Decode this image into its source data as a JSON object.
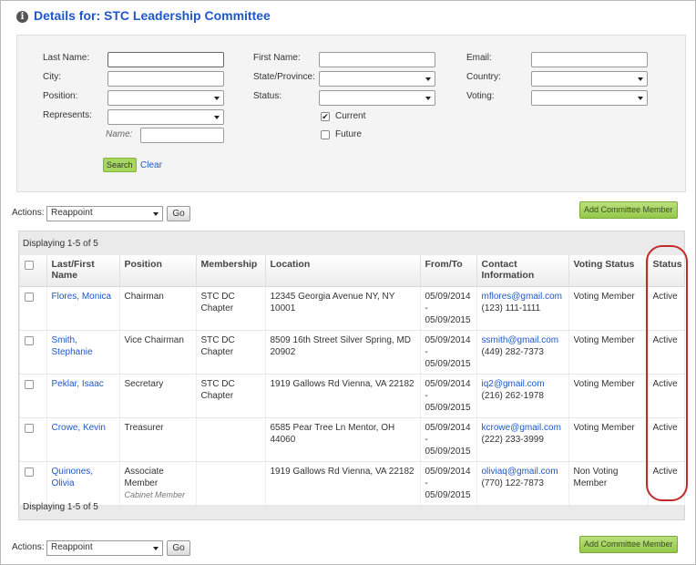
{
  "header": {
    "title": "Details for: STC Leadership Committee",
    "icon": "info-icon"
  },
  "search": {
    "last_name_label": "Last Name:",
    "first_name_label": "First Name:",
    "email_label": "Email:",
    "city_label": "City:",
    "state_label": "State/Province:",
    "country_label": "Country:",
    "position_label": "Position:",
    "status_label": "Status:",
    "voting_label": "Voting:",
    "represents_label": "Represents:",
    "name_label": "Name:",
    "current_label": "Current",
    "future_label": "Future",
    "current_checked": true,
    "future_checked": false,
    "search_button": "Search",
    "clear_link": "Clear"
  },
  "actions": {
    "label": "Actions:",
    "selected": "Reappoint",
    "go_button": "Go",
    "add_button": "Add Committee Member"
  },
  "grid": {
    "displaying_top": "Displaying 1-5 of 5",
    "displaying_bottom": "Displaying 1-5 of 5",
    "columns": {
      "name": "Last/First Name",
      "position": "Position",
      "membership": "Membership",
      "location": "Location",
      "from_to": "From/To",
      "contact": "Contact Information",
      "voting_status": "Voting Status",
      "status": "Status"
    },
    "rows": [
      {
        "name": "Flores, Monica",
        "position": "Chairman",
        "position_sub": "",
        "membership": "STC DC Chapter",
        "location": "12345 Georgia Avenue NY, NY 10001",
        "from": "05/09/2014",
        "dash": "-",
        "to": "05/09/2015",
        "email": "mflores@gmail.com",
        "phone": "(123) 111-1111",
        "voting": "Voting Member",
        "status": "Active"
      },
      {
        "name": "Smith, Stephanie",
        "position": "Vice Chairman",
        "position_sub": "",
        "membership": "STC DC Chapter",
        "location": "8509 16th Street Silver Spring, MD 20902",
        "from": "05/09/2014",
        "dash": "-",
        "to": "05/09/2015",
        "email": "ssmith@gmail.com",
        "phone": "(449) 282-7373",
        "voting": "Voting Member",
        "status": "Active"
      },
      {
        "name": "Peklar, Isaac",
        "position": "Secretary",
        "position_sub": "",
        "membership": "STC DC Chapter",
        "location": "1919 Gallows Rd Vienna, VA 22182",
        "from": "05/09/2014",
        "dash": "-",
        "to": "05/09/2015",
        "email": "iq2@gmail.com",
        "phone": "(216) 262-1978",
        "voting": "Voting Member",
        "status": "Active"
      },
      {
        "name": "Crowe, Kevin",
        "position": "Treasurer",
        "position_sub": "",
        "membership": "",
        "location": "6585 Pear Tree Ln Mentor, OH 44060",
        "from": "05/09/2014",
        "dash": "-",
        "to": "05/09/2015",
        "email": "kcrowe@gmail.com",
        "phone": "(222) 233-3999",
        "voting": "Voting Member",
        "status": "Active"
      },
      {
        "name": "Quinones, Olivia",
        "position": "Associate Member",
        "position_sub": "Cabinet Member",
        "membership": "",
        "location": "1919 Gallows Rd Vienna, VA 22182",
        "from": "05/09/2014",
        "dash": "-",
        "to": "05/09/2015",
        "email": "oliviaq@gmail.com",
        "phone": "(770) 122-7873",
        "voting": "Non Voting Member",
        "status": "Active"
      }
    ]
  },
  "colors": {
    "accent": "#1f57c8",
    "button_green": "#a7d65f",
    "highlight": "#c22a2a"
  }
}
